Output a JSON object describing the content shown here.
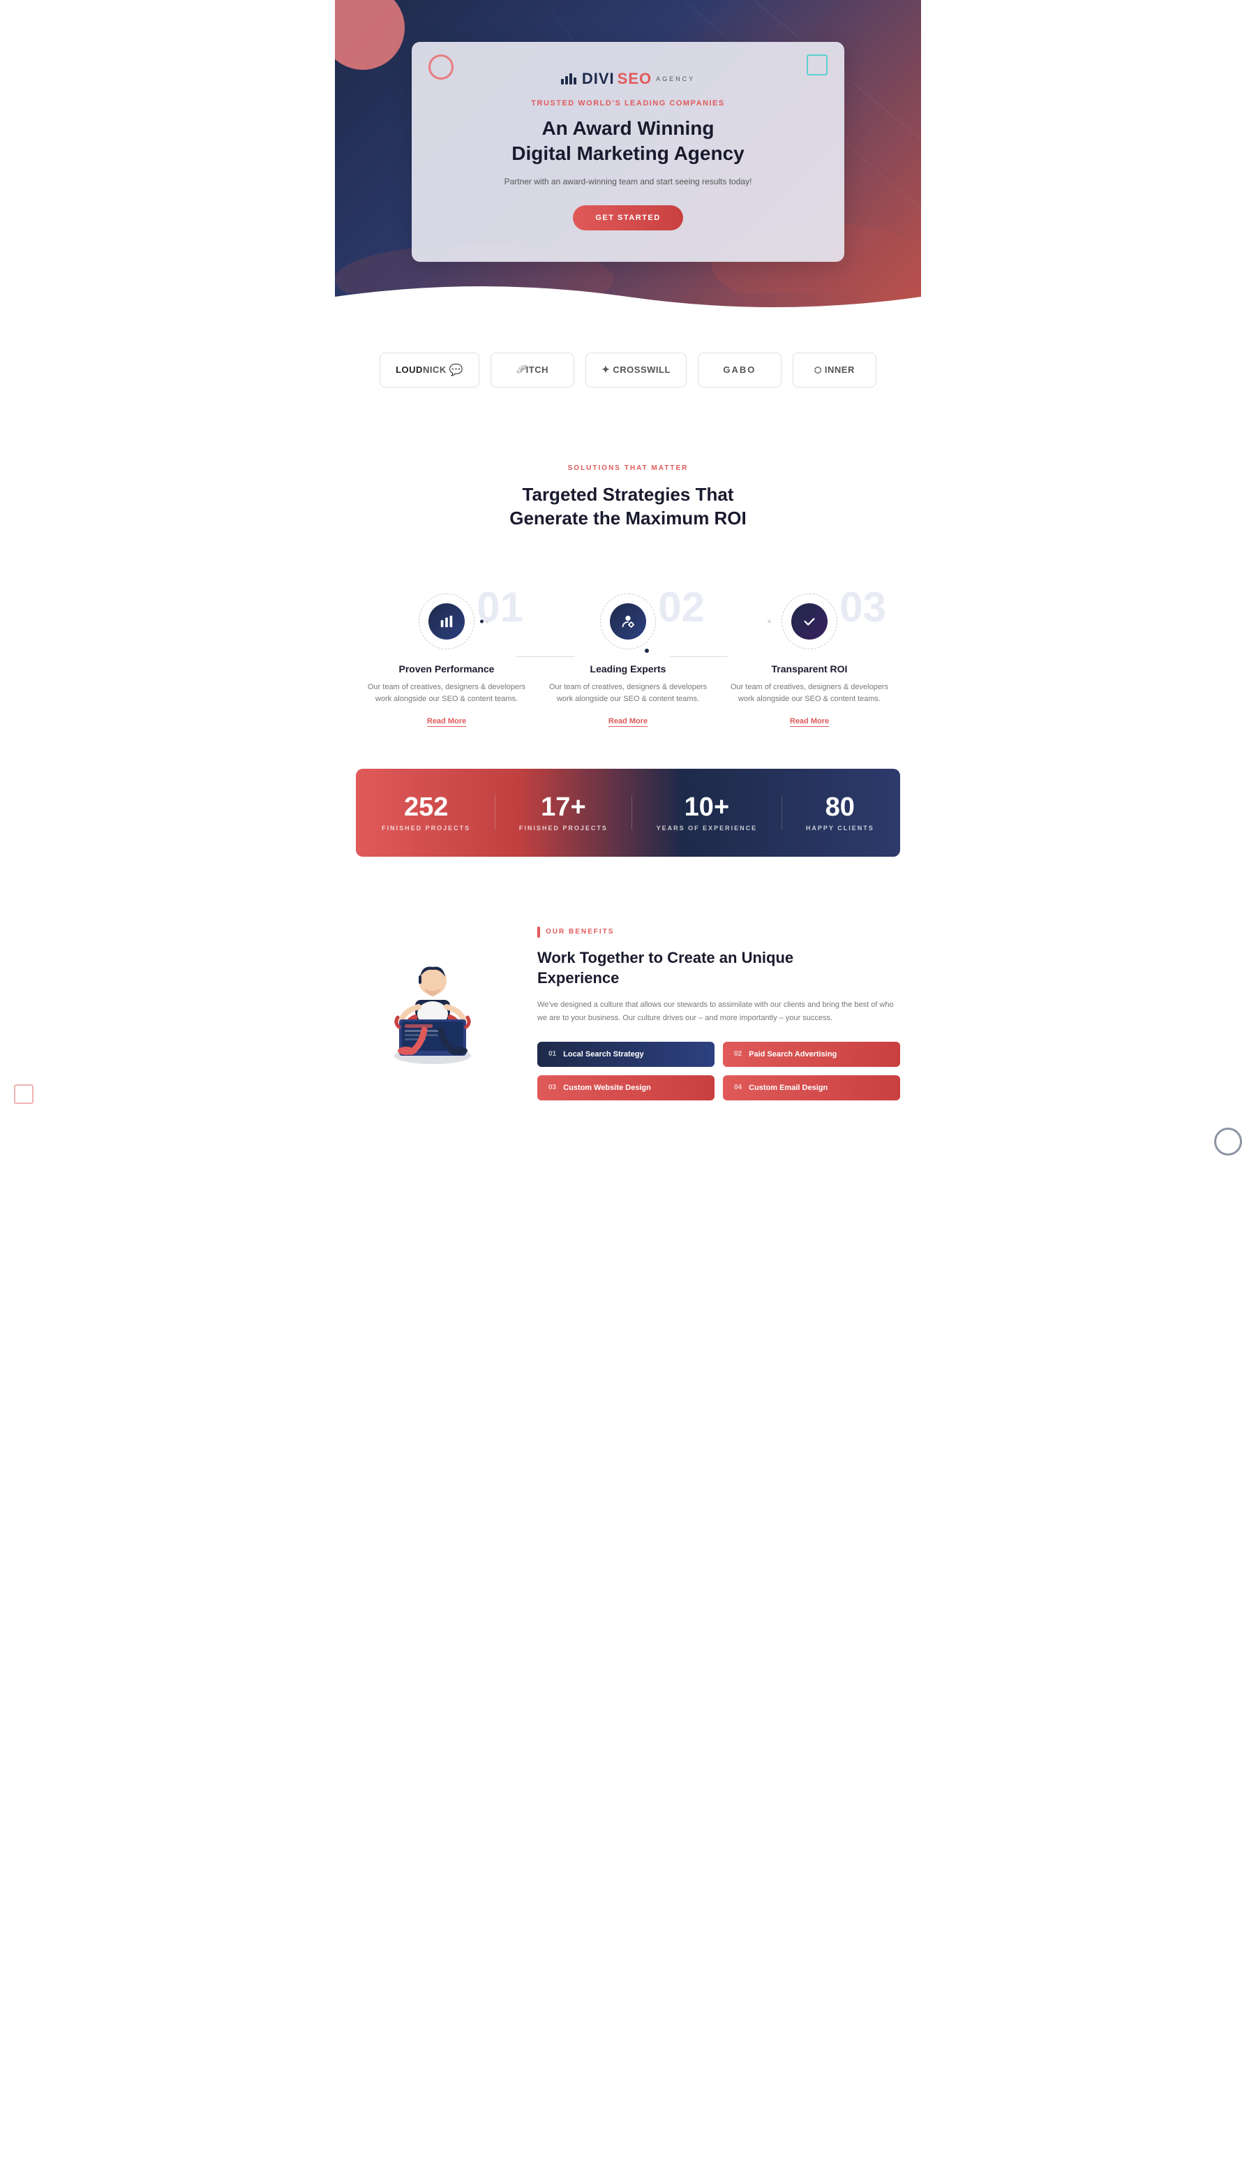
{
  "hero": {
    "logo_text": "DIVI",
    "logo_seo": "SEO",
    "logo_agency": "AGENCY",
    "trusted": "Trusted world's leading companies",
    "title_line1": "An Award Winning",
    "title_line2": "Digital Marketing Agency",
    "subtitle": "Partner with an award-winning team and start seeing results today!",
    "cta": "GET STARTED"
  },
  "logos": [
    {
      "id": "loudnick",
      "text": "LOUDNICK",
      "bold_part": "LOUD"
    },
    {
      "id": "pitch",
      "text": "PITCH"
    },
    {
      "id": "crosswill",
      "text": "CROSSWILL"
    },
    {
      "id": "gabo",
      "text": "GABO"
    },
    {
      "id": "inner",
      "text": "INNER"
    }
  ],
  "solutions": {
    "eyebrow": "SOLUTIONS THAT MATTER",
    "title_line1": "Targeted Strategies That",
    "title_line2": "Generate the Maximum ROI"
  },
  "features": [
    {
      "number": "01",
      "icon": "📊",
      "title": "Proven Performance",
      "desc": "Our team of creatives, designers & developers work alongside our SEO & content teams.",
      "read_more": "Read More"
    },
    {
      "number": "02",
      "icon": "👤",
      "title": "Leading Experts",
      "desc": "Our team of creatives, designers & developers work alongside our SEO & content teams.",
      "read_more": "Read More"
    },
    {
      "number": "03",
      "icon": "✓",
      "title": "Transparent ROI",
      "desc": "Our team of creatives, designers & developers work alongside our SEO & content teams.",
      "read_more": "Read More"
    }
  ],
  "stats": [
    {
      "number": "252",
      "label": "FINISHED PROJECTS"
    },
    {
      "number": "17+",
      "label": "FINISHED PROJECTS"
    },
    {
      "number": "10+",
      "label": "YEARS OF EXPERIENCE"
    },
    {
      "number": "80",
      "label": "HAPPY CLIENTS"
    }
  ],
  "benefits": {
    "eyebrow": "OUR BENEFITS",
    "title_line1": "Work Together to Create an Unique",
    "title_line2": "Experience",
    "desc": "We've designed a culture that allows our stewards to assimilate with our clients and bring the best of who we are to your business. Our culture drives our – and more importantly – your success.",
    "buttons": [
      {
        "num": "01",
        "label": "Local Search Strategy"
      },
      {
        "num": "02",
        "label": "Paid Search Advertising"
      },
      {
        "num": "03",
        "label": "Custom Website Design"
      },
      {
        "num": "04",
        "label": "Custom Email Design"
      }
    ]
  }
}
